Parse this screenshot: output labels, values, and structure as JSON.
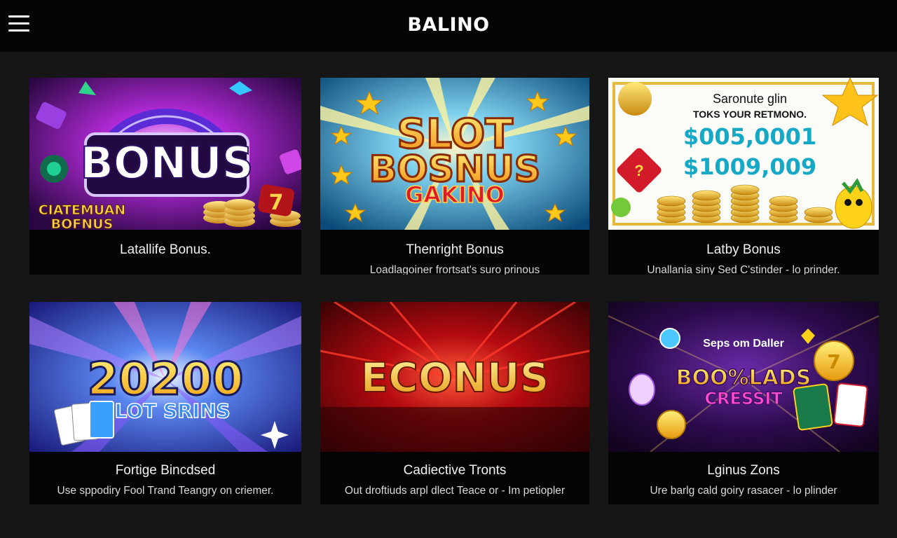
{
  "header": {
    "brand": "BALINO",
    "menu_icon": "hamburger-menu-icon"
  },
  "cards": [
    {
      "title": "Latallife Bonus.",
      "description": "",
      "art": {
        "headline": "BONUS",
        "sub1": "CIATEMUAN",
        "sub2": "BOFNUS",
        "accent": "#b22ad8"
      }
    },
    {
      "title": "Thenright Bonus",
      "description": "Loadlagoiner frortsat's suro prinous",
      "art": {
        "line1": "SLOT",
        "line2": "BOSNUS",
        "line3": "GAKINO",
        "accent": "#1a8fc7"
      }
    },
    {
      "title": "Latby Bonus",
      "description": "Unallania siny Sed C'stinder - lo prinder.",
      "art": {
        "line1": "Saronute glin",
        "line2": "TOKS YOUR RETMONO.",
        "amount1": "$005,0001",
        "amount2": "$1009,009",
        "accent": "#18a7c9"
      }
    },
    {
      "title": "Fortige Bincdsed",
      "description": "Use sppodiry Fool Trand Teangry on criemer.",
      "art": {
        "line1": "20200",
        "line2": "SLOT SRINS",
        "accent": "#2a4fd6"
      }
    },
    {
      "title": "Cadiective Tronts",
      "description": "Out droftiuds arpl dlect Teace or - Im petiopler",
      "art": {
        "line1": "ECONUS",
        "accent": "#c01212"
      }
    },
    {
      "title": "Lginus Zons",
      "description": "Ure barlg cald goiry rasacer - lo plinder",
      "art": {
        "line1": "Seps om Daller",
        "line2": "BOO%LADS",
        "line3": "CRESSIT",
        "accent": "#7b2cc4"
      }
    }
  ]
}
